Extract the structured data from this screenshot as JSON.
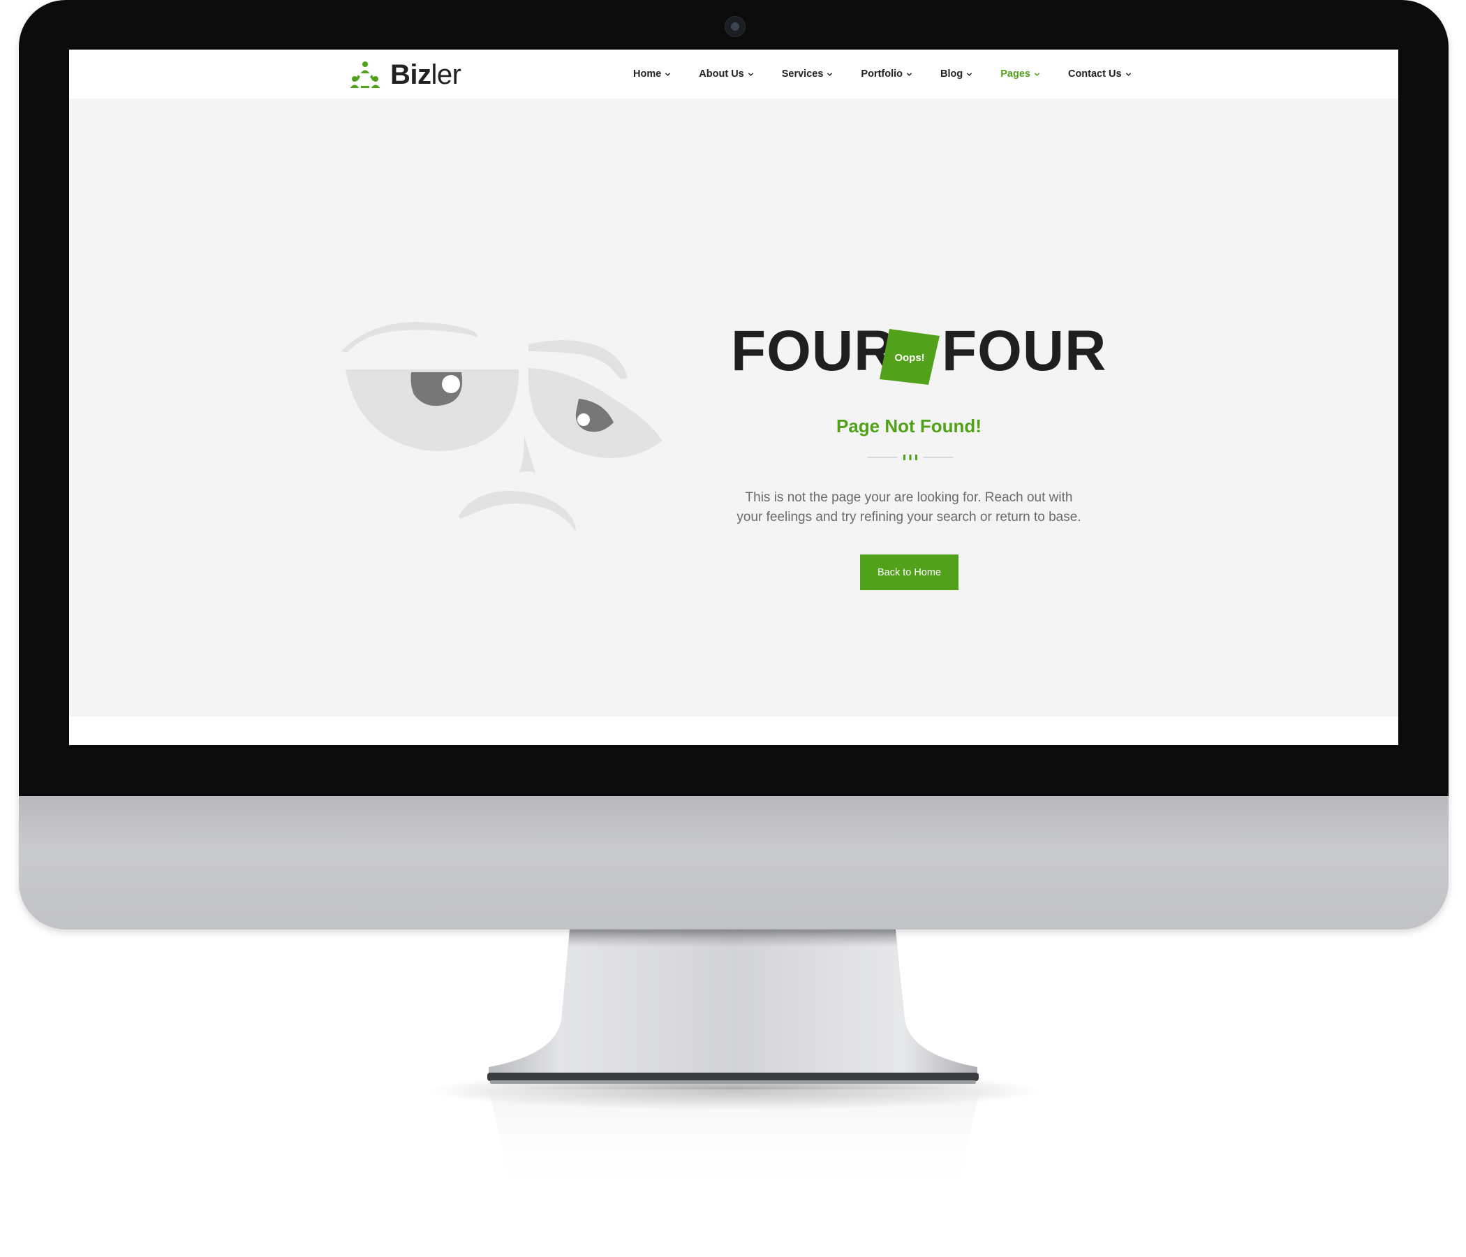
{
  "brand": {
    "name_bold": "Biz",
    "name_light": "ler",
    "accent_color": "#52a11b"
  },
  "nav": {
    "items": [
      {
        "label": "Home",
        "active": false
      },
      {
        "label": "About Us",
        "active": false
      },
      {
        "label": "Services",
        "active": false
      },
      {
        "label": "Portfolio",
        "active": false
      },
      {
        "label": "Blog",
        "active": false
      },
      {
        "label": "Pages",
        "active": true
      },
      {
        "label": "Contact Us",
        "active": false
      }
    ]
  },
  "error": {
    "word_left": "FOUR",
    "badge": "Oops!",
    "word_right": "FOUR",
    "title": "Page Not Found!",
    "message": "This is not the page your are looking for. Reach out with your feelings and try refining your search or return to base.",
    "button_label": "Back to Home"
  },
  "icons": {
    "logo": "people-triangle-icon",
    "nav_dropdown": "chevron-down-icon",
    "illustration": "sad-face-illustration"
  }
}
